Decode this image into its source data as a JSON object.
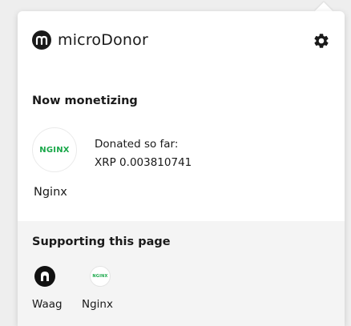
{
  "header": {
    "brand_name": "microDonor",
    "logo_glyph": "m",
    "settings_icon": "gear-icon"
  },
  "now_monetizing": {
    "title": "Now monetizing",
    "site_logo_text": "NGINX",
    "site_name": "Nginx",
    "donated_label": "Donated so far:",
    "donated_value": "XRP 0.003810741"
  },
  "supporting": {
    "title": "Supporting this page",
    "items": [
      {
        "name": "Waag",
        "icon": "waag-logo-icon"
      },
      {
        "name": "Nginx",
        "icon": "nginx-logo-icon",
        "logo_text": "NGINX"
      }
    ]
  },
  "colors": {
    "accent_nginx": "#1aa84a",
    "panel_bg": "#ffffff",
    "section_bg": "#f4f4f4"
  }
}
